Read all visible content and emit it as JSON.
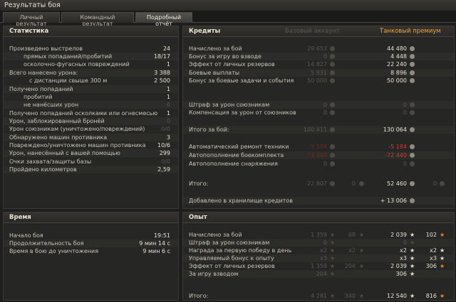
{
  "window": {
    "title": "Результаты боя"
  },
  "tabs": [
    {
      "label": "Личный результат",
      "active": false
    },
    {
      "label": "Командный результат",
      "active": false
    },
    {
      "label": "Подробный отчёт",
      "active": true
    }
  ],
  "stats": {
    "title": "Статистика",
    "rows": [
      {
        "label": "Произведено выстрелов",
        "value": "24",
        "indent": 0,
        "dim": false
      },
      {
        "label": "прямых попаданий/пробитий",
        "value": "18/17",
        "indent": 1,
        "dim": false
      },
      {
        "label": "осколочно-фугасных повреждений",
        "value": "1",
        "indent": 1,
        "dim": false
      },
      {
        "label": "Всего нанесено урона:",
        "value": "3 388",
        "indent": 0,
        "dim": false
      },
      {
        "label": "с дистанции свыше 300 м",
        "value": "2 500",
        "indent": 2,
        "dim": false
      },
      {
        "label": "Получено попаданий",
        "value": "1",
        "indent": 0,
        "dim": false
      },
      {
        "label": "пробитий",
        "value": "1",
        "indent": 1,
        "dim": false
      },
      {
        "label": "не нанёсших урон",
        "value": "0",
        "indent": 1,
        "dim": true
      },
      {
        "label": "Получено попаданий осколками или огнесмесью",
        "value": "1",
        "indent": 0,
        "dim": false
      },
      {
        "label": "Урон, заблокированный бронёй",
        "value": "0",
        "indent": 0,
        "dim": true
      },
      {
        "label": "Урон союзникам (уничтожено/повреждений)",
        "value": "0/0",
        "indent": 0,
        "dim": true
      },
      {
        "label": "Обнаружено машин противника",
        "value": "3",
        "indent": 0,
        "dim": false
      },
      {
        "label": "Повреждено/уничтожено машин противника",
        "value": "10/6",
        "indent": 0,
        "dim": false
      },
      {
        "label": "Урон, нанесённый с вашей помощью",
        "value": "299",
        "indent": 0,
        "dim": false
      },
      {
        "label": "Очки захвата/защиты базы",
        "value": "0/0",
        "indent": 0,
        "dim": true
      },
      {
        "label": "Пройдено километров",
        "value": "2,59",
        "indent": 0,
        "dim": false
      }
    ]
  },
  "time": {
    "title": "Время",
    "rows": [
      {
        "label": "Начало боя",
        "value": "19:51"
      },
      {
        "label": "Продолжительность боя",
        "value": "9 мин 14 с"
      },
      {
        "label": "Время в бою до уничтожения",
        "value": "9 мин 6 с"
      }
    ]
  },
  "credits": {
    "title": "Кредиты",
    "col_basic": "Базовый аккаунт",
    "col_premium": "Танковый премиум",
    "rows": [
      {
        "label": "Начислено за бой",
        "basic": "29 653",
        "premium": "44 480",
        "red": false,
        "dim": false
      },
      {
        "label": "Бонус за игру во взводе",
        "basic": "0",
        "premium": "4 448",
        "red": false,
        "dim": false
      },
      {
        "label": "Эффект от личных резервов",
        "basic": "14 827",
        "premium": "22 240",
        "red": false,
        "dim": false
      },
      {
        "label": "Боевые выплаты",
        "basic": "5 931",
        "premium": "8 896",
        "red": false,
        "dim": false
      },
      {
        "label": "Бонус за боевые задачи и события",
        "basic": "50 000",
        "premium": "50 000",
        "red": false,
        "dim": false
      },
      {
        "label": "Штраф за урон союзникам",
        "basic": "0",
        "premium": "0",
        "red": false,
        "dim": true
      },
      {
        "label": "Компенсация за урон от союзников",
        "basic": "0",
        "premium": "0",
        "red": false,
        "dim": true
      },
      {
        "label": "Итого за бой:",
        "basic": "100 411",
        "premium": "130 064",
        "red": false,
        "dim": false
      },
      {
        "label": "Автоматический ремонт техники",
        "basic": "-5 184",
        "premium": "-5 184",
        "red": true,
        "dim": false
      },
      {
        "label": "Автопополнение боекомплекта",
        "basic": "-72 440",
        "premium": "-72 440",
        "red": true,
        "dim": false
      },
      {
        "label": "Автопополнение снаряжения",
        "basic": "0",
        "premium": "0",
        "red": false,
        "dim": true
      }
    ],
    "total": {
      "label": "Итого:",
      "basic": "22 807",
      "basic_gold": "0",
      "premium": "52 460",
      "premium_gold": "0"
    },
    "vault": {
      "label": "Добавлено в хранилище кредитов",
      "value": "+ 13 006"
    }
  },
  "xp": {
    "title": "Опыт",
    "rows": [
      {
        "label": "Начислено за бой",
        "basic": "1 359",
        "basic_free": "68",
        "premium": "2 039",
        "premium_free": "102",
        "dim": false,
        "mult": false
      },
      {
        "label": "Штраф за урон союзникам",
        "basic": "0",
        "basic_free": "",
        "premium": "0",
        "premium_free": "",
        "dim": true,
        "mult": false
      },
      {
        "label": "Награда за первую победу в день",
        "basic": "x2",
        "basic_free": "x2",
        "premium": "x2",
        "premium_free": "x2",
        "dim": false,
        "mult": true
      },
      {
        "label": "Управляемый бонус к опыту",
        "basic": "x3",
        "basic_free": "",
        "premium": "x3",
        "premium_free": "x3",
        "dim": false,
        "mult": true
      },
      {
        "label": "Эффект от личных резервов",
        "basic": "1 359",
        "basic_free": "204",
        "premium": "2 039",
        "premium_free": "306",
        "dim": false,
        "mult": false
      },
      {
        "label": "За игру взводом",
        "basic": "204",
        "basic_free": "",
        "premium": "306",
        "premium_free": "",
        "dim": false,
        "mult": false
      }
    ],
    "total": {
      "label": "Итого:",
      "basic": "4 281",
      "basic_free": "340",
      "premium": "12 540",
      "premium_free": "816"
    }
  },
  "icons": {
    "credit": "credit-coin-icon",
    "gold": "gold-coin-icon",
    "xp": "xp-star-icon",
    "free_xp": "free-xp-star-icon"
  }
}
